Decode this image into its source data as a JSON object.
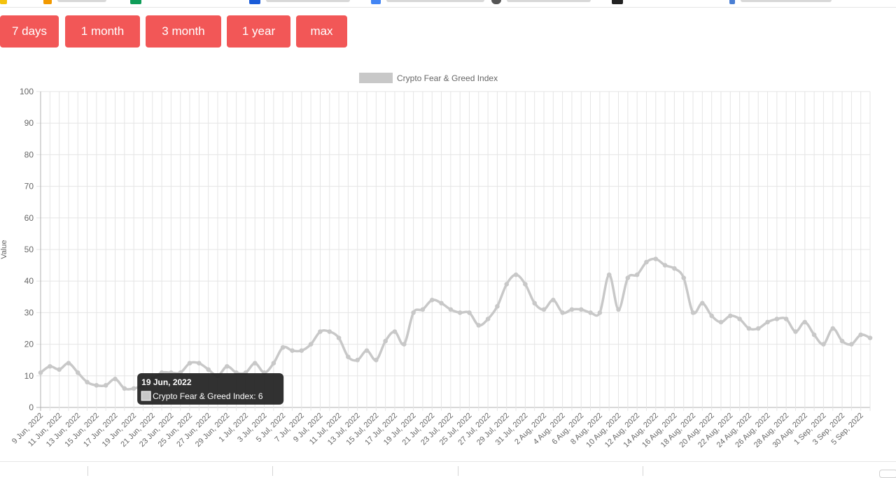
{
  "range_buttons": [
    {
      "label": "7 days"
    },
    {
      "label": "1 month"
    },
    {
      "label": "3 month"
    },
    {
      "label": "1 year"
    },
    {
      "label": "max"
    }
  ],
  "colors": {
    "button": "#f25757",
    "line": "#c8c8c8",
    "grid": "#e5e5e5",
    "axis_text": "#666666",
    "tooltip_bg": "#1f1f1f"
  },
  "tooltip": {
    "title": "19 Jun, 2022",
    "body": "Crypto Fear & Greed Index: 6",
    "index": 10
  },
  "chart_data": {
    "type": "line",
    "title": "",
    "xlabel": "",
    "ylabel": "Value",
    "ylim": [
      0,
      100
    ],
    "yticks": [
      0,
      10,
      20,
      30,
      40,
      50,
      60,
      70,
      80,
      90,
      100
    ],
    "grid": true,
    "legend_position": "top",
    "x_tick_labels": [
      "9 Jun, 2022",
      "11 Jun, 2022",
      "13 Jun, 2022",
      "15 Jun, 2022",
      "17 Jun, 2022",
      "19 Jun, 2022",
      "21 Jun, 2022",
      "23 Jun, 2022",
      "25 Jun, 2022",
      "27 Jun, 2022",
      "29 Jun, 2022",
      "1 Jul, 2022",
      "3 Jul, 2022",
      "5 Jul, 2022",
      "7 Jul, 2022",
      "9 Jul, 2022",
      "11 Jul, 2022",
      "13 Jul, 2022",
      "15 Jul, 2022",
      "17 Jul, 2022",
      "19 Jul, 2022",
      "21 Jul, 2022",
      "23 Jul, 2022",
      "25 Jul, 2022",
      "27 Jul, 2022",
      "29 Jul, 2022",
      "31 Jul, 2022",
      "2 Aug, 2022",
      "4 Aug, 2022",
      "6 Aug, 2022",
      "8 Aug, 2022",
      "10 Aug, 2022",
      "12 Aug, 2022",
      "14 Aug, 2022",
      "16 Aug, 2022",
      "18 Aug, 2022",
      "20 Aug, 2022",
      "22 Aug, 2022",
      "24 Aug, 2022",
      "26 Aug, 2022",
      "28 Aug, 2022",
      "30 Aug, 2022",
      "1 Sep, 2022",
      "3 Sep, 2022",
      "5 Sep, 2022"
    ],
    "series": [
      {
        "name": "Crypto Fear & Greed Index",
        "values": [
          11,
          13,
          12,
          14,
          11,
          8,
          7,
          7,
          9,
          6,
          6,
          7,
          9,
          11,
          11,
          11,
          14,
          14,
          12,
          10,
          13,
          11,
          11,
          14,
          11,
          14,
          19,
          18,
          18,
          20,
          24,
          24,
          22,
          16,
          15,
          18,
          15,
          21,
          24,
          20,
          30,
          31,
          34,
          33,
          31,
          30,
          30,
          26,
          28,
          32,
          39,
          42,
          39,
          33,
          31,
          34,
          30,
          31,
          31,
          30,
          30,
          42,
          31,
          41,
          42,
          46,
          47,
          45,
          44,
          41,
          30,
          33,
          29,
          27,
          29,
          28,
          25,
          25,
          27,
          28,
          28,
          24,
          27,
          23,
          20,
          25,
          21,
          20,
          23,
          22
        ]
      }
    ]
  }
}
